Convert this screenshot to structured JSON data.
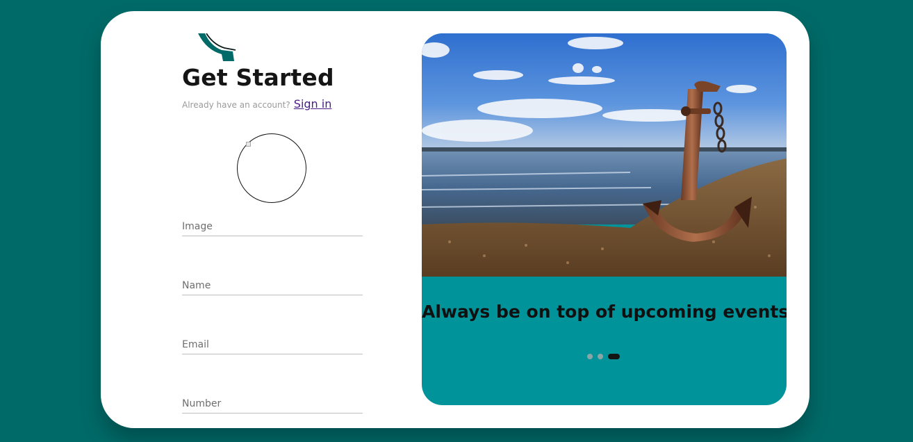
{
  "form": {
    "title": "Get Started",
    "signin_prompt": "Already have an account?",
    "signin_link": "Sign in",
    "fields": {
      "image_placeholder": "Image",
      "name_placeholder": "Name",
      "email_placeholder": "Email",
      "number_placeholder": "Number"
    }
  },
  "slider": {
    "caption": "Always be on top of upcoming events!",
    "image_icon": "anchor-beach-photo",
    "slide_count": 3,
    "active_slide": 3
  },
  "colors": {
    "background": "#006a68",
    "card": "#ffffff",
    "accent_panel": "#00949a",
    "logo": "#006a68",
    "link": "#4b1a86"
  }
}
